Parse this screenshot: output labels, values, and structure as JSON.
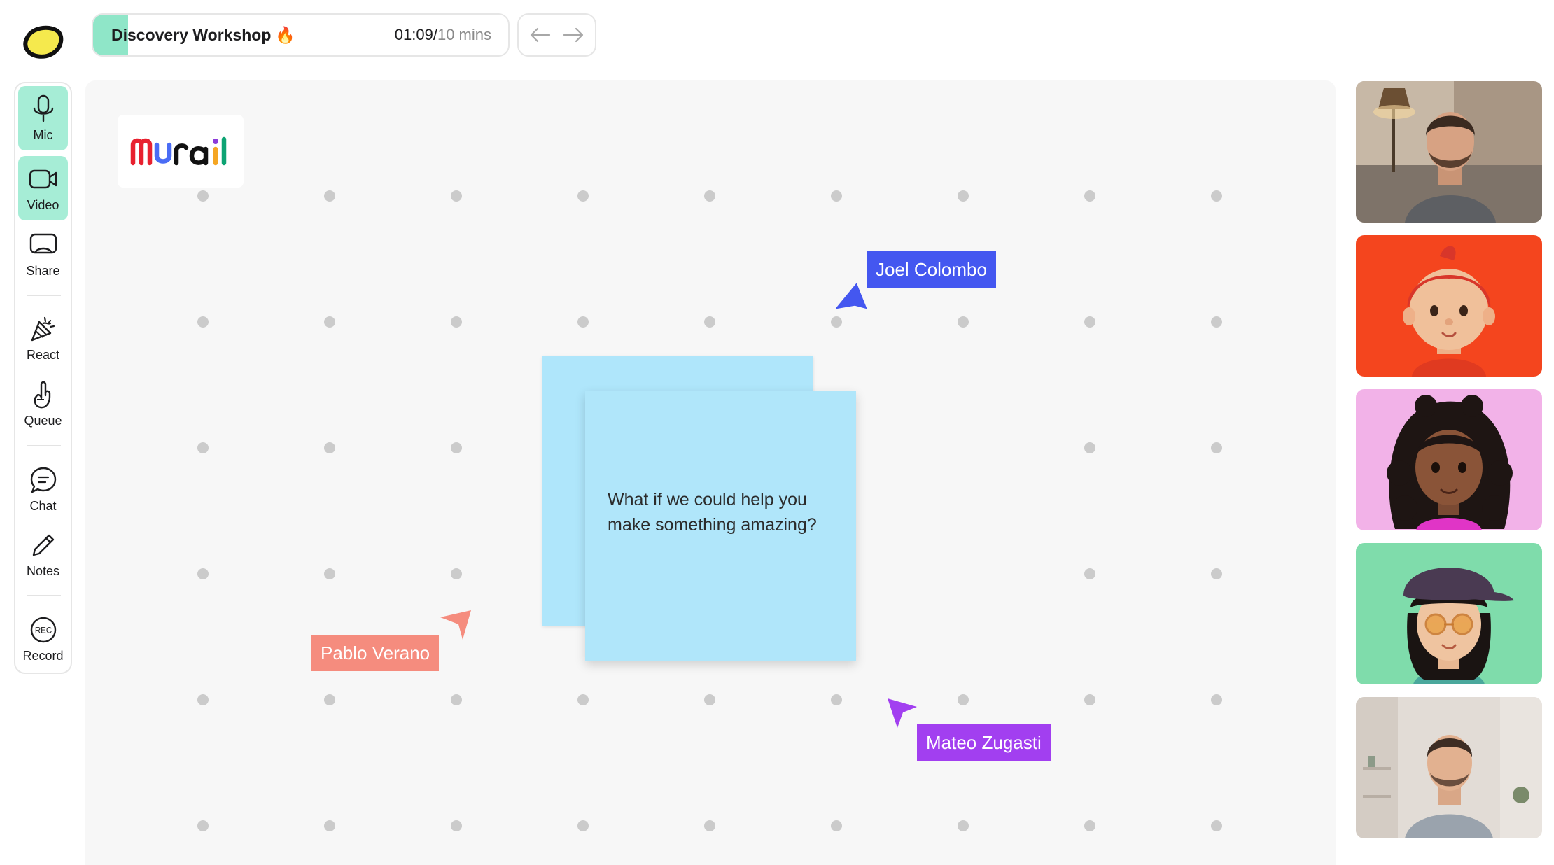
{
  "session": {
    "title": "Discovery Workshop",
    "title_emoji": "🔥",
    "elapsed": "01:09",
    "separator": "/",
    "total": "10 mins",
    "progress_percent": 8.5
  },
  "colors": {
    "accent_green": "#a6edd6",
    "progress_green": "#8fe6c8",
    "sticky_blue": "#b0e6fa",
    "joel_blue": "#4457f0",
    "pablo_salmon": "#f58c7e",
    "mateo_purple": "#a23ff0"
  },
  "toolbar": {
    "items": [
      {
        "label": "Mic",
        "icon": "microphone-icon",
        "active": true
      },
      {
        "label": "Video",
        "icon": "video-camera-icon",
        "active": true
      },
      {
        "label": "Share",
        "icon": "screen-share-icon",
        "active": false
      },
      {
        "label": "React",
        "icon": "party-popper-icon",
        "active": false
      },
      {
        "label": "Queue",
        "icon": "raised-hand-icon",
        "active": false
      },
      {
        "label": "Chat",
        "icon": "chat-bubble-icon",
        "active": false
      },
      {
        "label": "Notes",
        "icon": "pencil-icon",
        "active": false
      },
      {
        "label": "Record",
        "icon": "record-icon",
        "active": false
      }
    ],
    "rec_badge": "REC"
  },
  "board": {
    "logo_text": "Mural",
    "sticky_text": "What if we could help you make something amazing?"
  },
  "cursors": [
    {
      "name": "Joel Colombo",
      "color": "#4457f0"
    },
    {
      "name": "Pablo Verano",
      "color": "#f58c7e"
    },
    {
      "name": "Mateo Zugasti",
      "color": "#a23ff0"
    }
  ],
  "participants": [
    {
      "name": "participant-1",
      "kind": "video",
      "background": "#8a7a6a"
    },
    {
      "name": "participant-2",
      "kind": "avatar",
      "background": "#f4451e"
    },
    {
      "name": "participant-3",
      "kind": "avatar",
      "background": "#f2b2e8"
    },
    {
      "name": "participant-4",
      "kind": "avatar",
      "background": "#7fdcab"
    },
    {
      "name": "participant-5",
      "kind": "video",
      "background": "#d8d2cc"
    }
  ]
}
